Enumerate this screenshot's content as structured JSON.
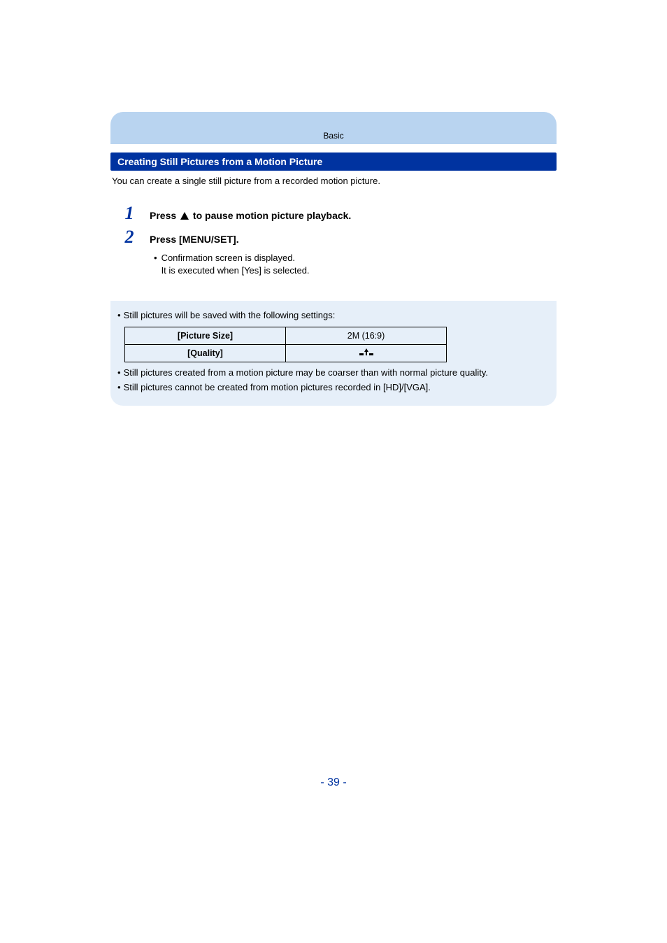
{
  "header": {
    "section": "Basic"
  },
  "title": "Creating Still Pictures from a Motion Picture",
  "intro": "You can create a single still picture from a recorded motion picture.",
  "steps": [
    {
      "num": "1",
      "pre": "Press ",
      "post": " to pause motion picture playback."
    },
    {
      "num": "2",
      "text": "Press [MENU/SET]."
    }
  ],
  "sub": {
    "line1": "Confirmation screen is displayed.",
    "line2": "It is executed when [Yes] is selected."
  },
  "notes": {
    "n1": "Still pictures will be saved with the following settings:",
    "table": {
      "r1h": "[Picture Size]",
      "r1v": "2M (16:9)",
      "r2h": "[Quality]"
    },
    "n2": "Still pictures created from a motion picture may be coarser than with normal picture quality.",
    "n3": "Still pictures cannot be created from motion pictures recorded in [HD]/[VGA]."
  },
  "pagenum": "- 39 -"
}
